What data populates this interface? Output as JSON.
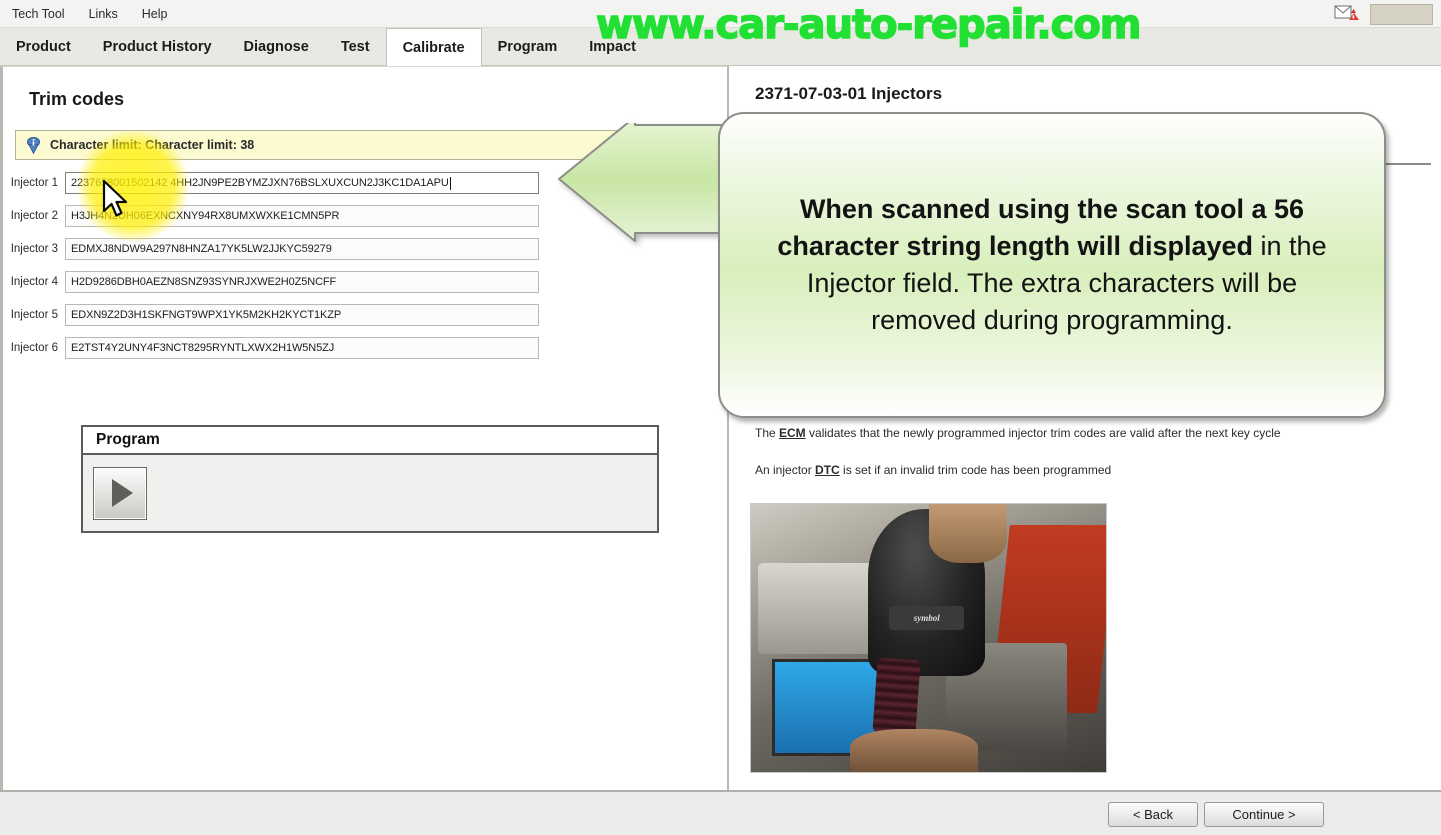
{
  "app": {
    "watermark": "www.car-auto-repair.com",
    "watermark_color": "#22e033"
  },
  "menubar": {
    "items": [
      {
        "label": "Tech Tool"
      },
      {
        "label": "Links"
      },
      {
        "label": "Help"
      }
    ],
    "mail_icon": "mail-alert-icon"
  },
  "tabs": [
    {
      "label": "Product",
      "active": false
    },
    {
      "label": "Product History",
      "active": false
    },
    {
      "label": "Diagnose",
      "active": false
    },
    {
      "label": "Test",
      "active": false
    },
    {
      "label": "Calibrate",
      "active": true
    },
    {
      "label": "Program",
      "active": false
    },
    {
      "label": "Impact",
      "active": false
    }
  ],
  "left": {
    "page_title": "Trim codes",
    "notice": {
      "icon": "info-icon",
      "text": "Character limit: Character limit: 38"
    },
    "injectors": [
      {
        "label": "Injector 1",
        "value": "2237658001502142 4HH2JN9PE2BYMZJXN76BSLXUXCUN2J3KC1DA1APU",
        "focused": true
      },
      {
        "label": "Injector 2",
        "value": "H3JH4N2UH06EXNCXNY94RX8UMXWXKE1CMN5PR",
        "focused": false
      },
      {
        "label": "Injector 3",
        "value": "EDMXJ8NDW9A297N8HNZA17YK5LW2JJKYC59279",
        "focused": false
      },
      {
        "label": "Injector 4",
        "value": "H2D9286DBH0AEZN8SNZ93SYNRJXWE2H0Z5NCFF",
        "focused": false
      },
      {
        "label": "Injector 5",
        "value": "EDXN9Z2D3H1SKFNGT9WPX1YK5M2KH2KYCT1KZP",
        "focused": false
      },
      {
        "label": "Injector 6",
        "value": "E2TST4Y2UNY4F3NCT8295RYNTLXWX2H1W5N5ZJ",
        "focused": false
      }
    ],
    "program_group": {
      "title": "Program",
      "play_button": "play-icon"
    }
  },
  "right": {
    "title": "2371-07-03-01 Injectors",
    "paragraphs": [
      {
        "pre": "The ",
        "term": "ECM",
        "post": " validates that the newly programmed injector trim codes are valid after the next key cycle"
      },
      {
        "pre": "An injector ",
        "term": "DTC",
        "post": " is set if an invalid trim code has been programmed"
      }
    ],
    "photo_caption": "symbol",
    "photo_alt": "technician scanning injector barcode with Symbol handheld scanner"
  },
  "callout": {
    "bold_part_1": "When scanned using the scan tool a 56 character string length will displayed",
    "normal_part": " in the Injector field. The extra characters will be removed during programming."
  },
  "bottom": {
    "back_label": "< Back",
    "continue_label": "Continue >"
  }
}
